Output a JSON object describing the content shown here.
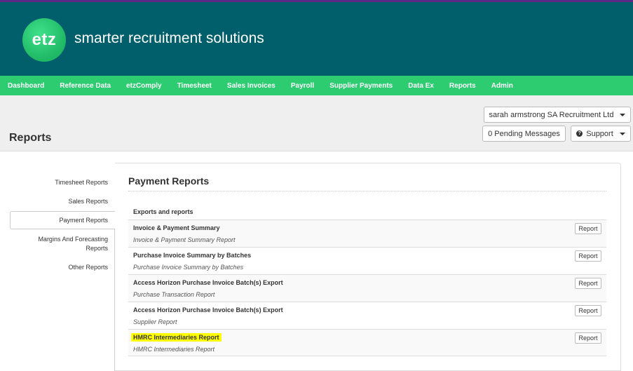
{
  "brand": {
    "logo_text": "etz",
    "tagline": "smarter recruitment solutions"
  },
  "nav": [
    "Dashboard",
    "Reference Data",
    "etzComply",
    "Timesheet",
    "Sales Invoices",
    "Payroll",
    "Supplier Payments",
    "Data Ex",
    "Reports",
    "Admin"
  ],
  "account": {
    "user_label": "sarah armstrong SA Recruitment Ltd",
    "pending_label": "0 Pending Messages",
    "support_label": "Support"
  },
  "page": {
    "title": "Reports"
  },
  "sidebar": {
    "items": [
      {
        "label": "Timesheet Reports"
      },
      {
        "label": "Sales Reports"
      },
      {
        "label": "Payment Reports"
      },
      {
        "label": "Margins And Forecasting Reports"
      },
      {
        "label": "Other Reports"
      }
    ],
    "active_index": 2
  },
  "content": {
    "title": "Payment Reports",
    "table_header": "Exports and reports",
    "report_button_label": "Report",
    "rows": [
      {
        "title": "Invoice & Payment Summary",
        "subtitle": "Invoice & Payment Summary Report",
        "highlighted": false
      },
      {
        "title": "Purchase Invoice Summary by Batches",
        "subtitle": "Purchase Invoice Summary by Batches",
        "highlighted": false
      },
      {
        "title": "Access Horizon Purchase Invoice Batch(s) Export",
        "subtitle": "Purchase Transaction Report",
        "highlighted": false
      },
      {
        "title": "Access Horizon Purchase Invoice Batch(s) Export",
        "subtitle": "Supplier Report",
        "highlighted": false
      },
      {
        "title": "HMRC Intermediaries Report",
        "subtitle": "HMRC Intermediaries Report",
        "highlighted": true
      }
    ]
  },
  "colors": {
    "header_bg": "#005f6b",
    "nav_bg": "#2ecc71",
    "logo_green": "#1fb864",
    "highlight": "#ffff00",
    "top_line": "#5b2a86"
  }
}
